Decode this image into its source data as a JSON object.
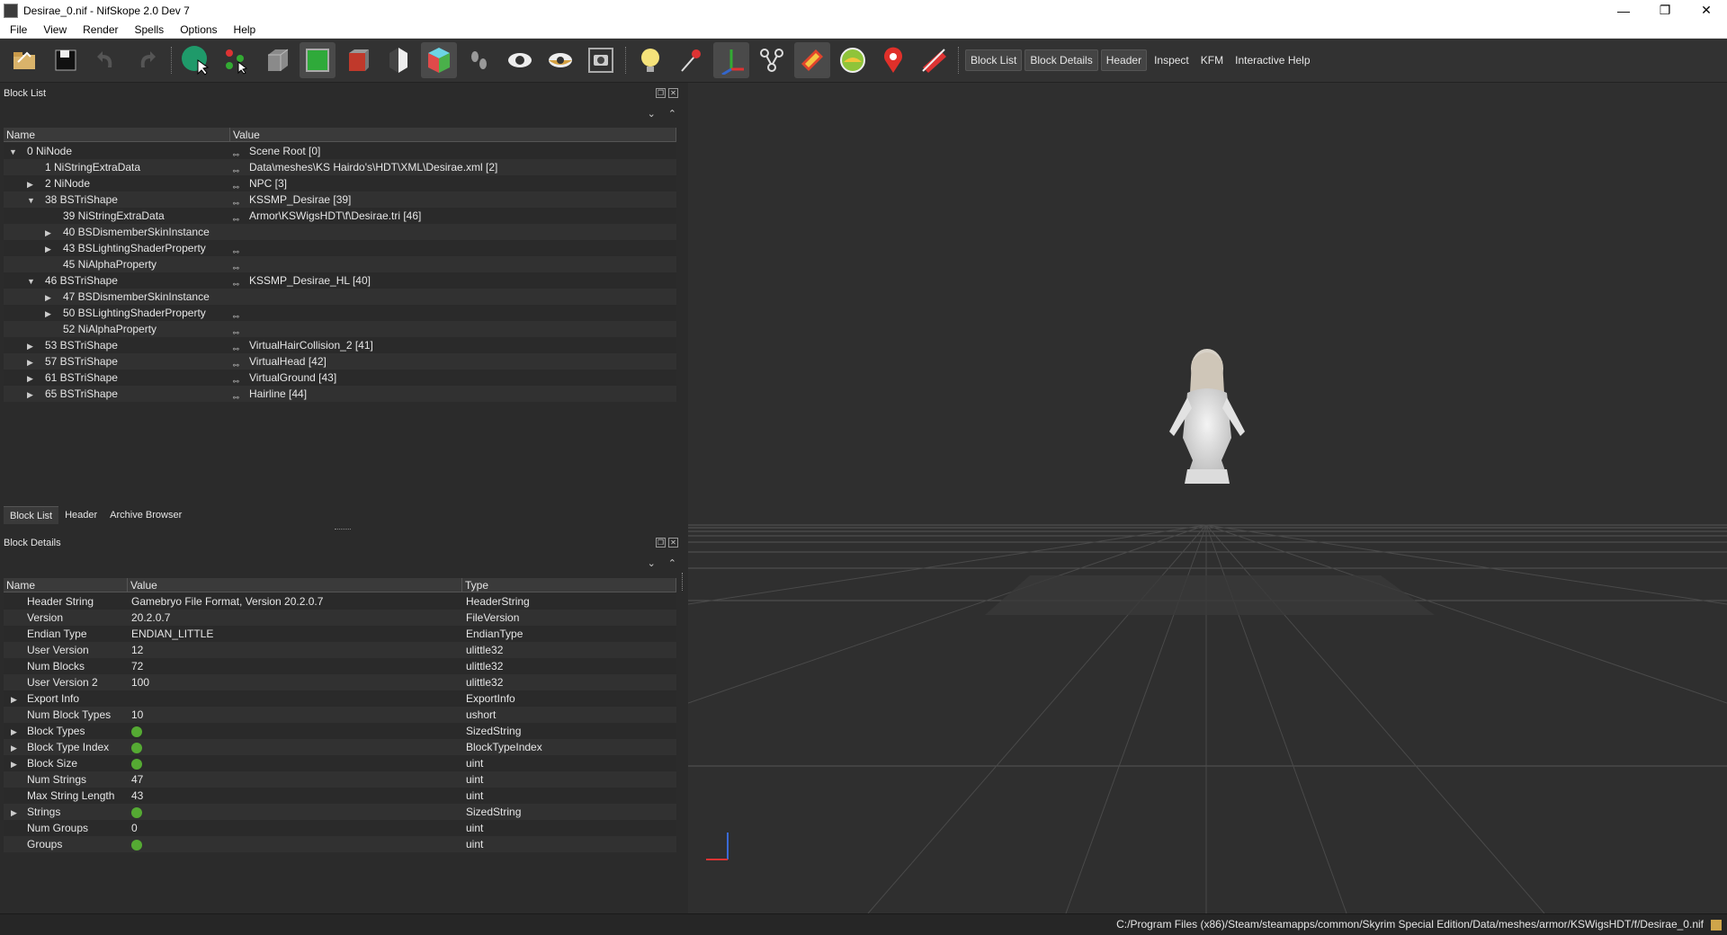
{
  "window": {
    "title": "Desirae_0.nif - NifSkope 2.0 Dev 7",
    "minimize": "—",
    "restore": "❐",
    "close": "✕"
  },
  "menu": [
    "File",
    "View",
    "Render",
    "Spells",
    "Options",
    "Help"
  ],
  "toolbar": {
    "icons": [
      "open-icon",
      "save-icon",
      "undo-icon",
      "redo-icon",
      "select-object-icon",
      "select-vertex-icon",
      "box-flat-icon",
      "box-green-icon",
      "box-red-icon",
      "half-shape-icon",
      "color-cube-icon",
      "footprints-icon",
      "eye-icon",
      "eye-outline-icon",
      "screenshot-icon",
      "light-bulb-icon",
      "pin-tool-icon",
      "axes-icon",
      "nodes-icon",
      "texture-stripe-icon",
      "circle-green-icon",
      "location-marker-icon",
      "hide-icon"
    ],
    "text_buttons": [
      "Block List",
      "Block Details",
      "Header",
      "Inspect",
      "KFM",
      "Interactive Help"
    ]
  },
  "block_list": {
    "title": "Block List",
    "headers": [
      "Name",
      "Value"
    ],
    "rows": [
      {
        "indent": 0,
        "arrow": "▼",
        "name": "0 NiNode",
        "link": true,
        "value": "Scene Root [0]"
      },
      {
        "indent": 1,
        "arrow": "",
        "name": "1 NiStringExtraData",
        "link": true,
        "value": "Data\\meshes\\KS Hairdo's\\HDT\\XML\\Desirae.xml [2]"
      },
      {
        "indent": 1,
        "arrow": "▶",
        "name": "2 NiNode",
        "link": true,
        "value": "NPC [3]"
      },
      {
        "indent": 1,
        "arrow": "▼",
        "name": "38 BSTriShape",
        "link": true,
        "value": "KSSMP_Desirae [39]"
      },
      {
        "indent": 2,
        "arrow": "",
        "name": "39 NiStringExtraData",
        "link": true,
        "value": "Armor\\KSWigsHDT\\f\\Desirae.tri [46]"
      },
      {
        "indent": 2,
        "arrow": "▶",
        "name": "40 BSDismemberSkinInstance",
        "link": false,
        "value": ""
      },
      {
        "indent": 2,
        "arrow": "▶",
        "name": "43 BSLightingShaderProperty",
        "link": true,
        "value": ""
      },
      {
        "indent": 2,
        "arrow": "",
        "name": "45 NiAlphaProperty",
        "link": true,
        "value": ""
      },
      {
        "indent": 1,
        "arrow": "▼",
        "name": "46 BSTriShape",
        "link": true,
        "value": "KSSMP_Desirae_HL [40]"
      },
      {
        "indent": 2,
        "arrow": "▶",
        "name": "47 BSDismemberSkinInstance",
        "link": false,
        "value": ""
      },
      {
        "indent": 2,
        "arrow": "▶",
        "name": "50 BSLightingShaderProperty",
        "link": true,
        "value": ""
      },
      {
        "indent": 2,
        "arrow": "",
        "name": "52 NiAlphaProperty",
        "link": true,
        "value": ""
      },
      {
        "indent": 1,
        "arrow": "▶",
        "name": "53 BSTriShape",
        "link": true,
        "value": "VirtualHairCollision_2 [41]"
      },
      {
        "indent": 1,
        "arrow": "▶",
        "name": "57 BSTriShape",
        "link": true,
        "value": "VirtualHead [42]"
      },
      {
        "indent": 1,
        "arrow": "▶",
        "name": "61 BSTriShape",
        "link": true,
        "value": "VirtualGround [43]"
      },
      {
        "indent": 1,
        "arrow": "▶",
        "name": "65 BSTriShape",
        "link": true,
        "value": "Hairline [44]"
      }
    ]
  },
  "tabs": [
    "Block List",
    "Header",
    "Archive Browser"
  ],
  "block_details": {
    "title": "Block Details",
    "headers": [
      "Name",
      "Value",
      "Type"
    ],
    "rows": [
      {
        "arrow": "",
        "name": "Header String",
        "value": "Gamebryo File Format, Version 20.2.0.7",
        "refresh": false,
        "type": "HeaderString"
      },
      {
        "arrow": "",
        "name": "Version",
        "value": "20.2.0.7",
        "refresh": false,
        "type": "FileVersion"
      },
      {
        "arrow": "",
        "name": "Endian Type",
        "value": "ENDIAN_LITTLE",
        "refresh": false,
        "type": "EndianType"
      },
      {
        "arrow": "",
        "name": "User Version",
        "value": "12",
        "refresh": false,
        "type": "ulittle32"
      },
      {
        "arrow": "",
        "name": "Num Blocks",
        "value": "72",
        "refresh": false,
        "type": "ulittle32"
      },
      {
        "arrow": "",
        "name": "User Version 2",
        "value": "100",
        "refresh": false,
        "type": "ulittle32"
      },
      {
        "arrow": "▶",
        "name": "Export Info",
        "value": "",
        "refresh": false,
        "type": "ExportInfo"
      },
      {
        "arrow": "",
        "name": "Num Block Types",
        "value": "10",
        "refresh": false,
        "type": "ushort"
      },
      {
        "arrow": "▶",
        "name": "Block Types",
        "value": "",
        "refresh": true,
        "type": "SizedString"
      },
      {
        "arrow": "▶",
        "name": "Block Type Index",
        "value": "",
        "refresh": true,
        "type": "BlockTypeIndex"
      },
      {
        "arrow": "▶",
        "name": "Block Size",
        "value": "",
        "refresh": true,
        "type": "uint"
      },
      {
        "arrow": "",
        "name": "Num Strings",
        "value": "47",
        "refresh": false,
        "type": "uint"
      },
      {
        "arrow": "",
        "name": "Max String Length",
        "value": "43",
        "refresh": false,
        "type": "uint"
      },
      {
        "arrow": "▶",
        "name": "Strings",
        "value": "",
        "refresh": true,
        "type": "SizedString"
      },
      {
        "arrow": "",
        "name": "Num Groups",
        "value": "0",
        "refresh": false,
        "type": "uint"
      },
      {
        "arrow": "",
        "name": "Groups",
        "value": "",
        "refresh": true,
        "type": "uint"
      }
    ]
  },
  "status": {
    "path": "C:/Program Files (x86)/Steam/steamapps/common/Skyrim Special Edition/Data/meshes/armor/KSWigsHDT/f/Desirae_0.nif"
  }
}
